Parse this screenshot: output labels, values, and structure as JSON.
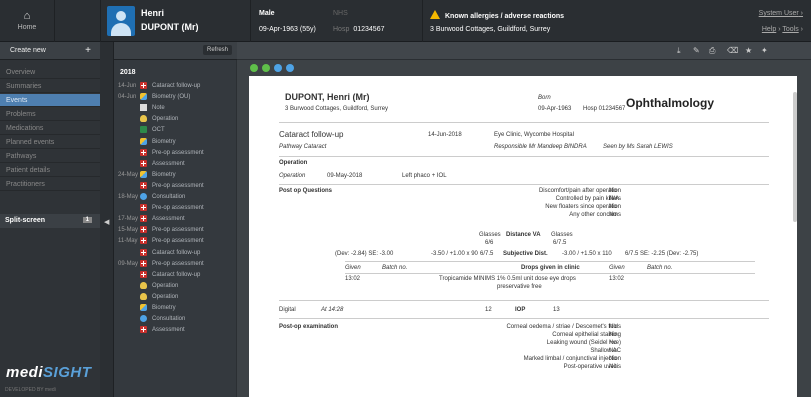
{
  "header": {
    "home_label": "Home",
    "patient_first": "Henri",
    "patient_last": "DUPONT (Mr)",
    "gender": "Male",
    "dob": "09-Apr-1963 (55y)",
    "nhs_label": "NHS",
    "hosp_label": "Hosp",
    "hosp_no": "01234567",
    "allergy": "Known allergies / adverse reactions",
    "address": "3 Burwood Cottages, Guildford, Surrey",
    "system_user": "System User",
    "help": "Help",
    "tools": "Tools",
    "warn_color": "#f5b800"
  },
  "nav": {
    "create_new": "Create new",
    "items": [
      "Overview",
      "Summaries",
      "Events",
      "Problems",
      "Medications",
      "Planned events",
      "Pathways",
      "Patient details",
      "Practitioners"
    ],
    "active": "Events",
    "split": "Split-screen",
    "split_badge": "1",
    "logo_main": "medi",
    "logo_accent": "SIGHT",
    "developed_by": "DEVELOPED BY  medi"
  },
  "events": {
    "refresh": "Refresh",
    "year": "2018",
    "list": [
      {
        "date": "14-Jun",
        "icon": "red-plus-icon",
        "label": "Cataract follow-up"
      },
      {
        "date": "04-Jun",
        "icon": "biometry-icon",
        "label": "Biometry (OU)"
      },
      {
        "date": "",
        "icon": "note-icon",
        "label": "Note"
      },
      {
        "date": "",
        "icon": "operation-icon",
        "label": "Operation"
      },
      {
        "date": "",
        "icon": "oct-icon",
        "label": "OCT"
      },
      {
        "date": "",
        "icon": "biometry-icon",
        "label": "Biometry"
      },
      {
        "date": "",
        "icon": "red-plus-icon",
        "label": "Pre-op assessment"
      },
      {
        "date": "",
        "icon": "red-plus-icon",
        "label": "Assessment"
      },
      {
        "date": "24-May",
        "icon": "biometry-icon",
        "label": "Biometry"
      },
      {
        "date": "",
        "icon": "red-plus-icon",
        "label": "Pre-op assessment"
      },
      {
        "date": "18-May",
        "icon": "consultation-icon",
        "label": "Consultation"
      },
      {
        "date": "",
        "icon": "red-plus-icon",
        "label": "Pre-op assessment"
      },
      {
        "date": "17-May",
        "icon": "red-plus-icon",
        "label": "Assessment"
      },
      {
        "date": "15-May",
        "icon": "red-plus-icon",
        "label": "Pre-op assessment"
      },
      {
        "date": "11-May",
        "icon": "red-plus-icon",
        "label": "Pre-op assessment"
      },
      {
        "date": "",
        "icon": "red-plus-icon",
        "label": "Cataract follow-up"
      },
      {
        "date": "09-May",
        "icon": "red-plus-icon",
        "label": "Pre-op assessment"
      },
      {
        "date": "",
        "icon": "red-plus-icon",
        "label": "Cataract follow-up"
      },
      {
        "date": "",
        "icon": "operation-icon",
        "label": "Operation"
      },
      {
        "date": "",
        "icon": "operation-icon",
        "label": "Operation"
      },
      {
        "date": "",
        "icon": "biometry-icon",
        "label": "Biometry"
      },
      {
        "date": "",
        "icon": "consultation-icon",
        "label": "Consultation"
      },
      {
        "date": "",
        "icon": "red-plus-icon",
        "label": "Assessment"
      }
    ]
  },
  "doc": {
    "name": "DUPONT, Henri (Mr)",
    "address": "3 Burwood Cottages, Guildford, Surrey",
    "born_label": "Born",
    "born": "09-Apr-1963",
    "hosp": "Hosp 01234567",
    "specialty": "Ophthalmology",
    "event_title": "Cataract follow-up",
    "event_date": "14-Jun-2018",
    "site": "Eye Clinic, Wycombe Hospital",
    "pathway": "Pathway Cataract",
    "responsible": "Responsible  Mr Mandeep BINDRA",
    "seen_by": "Seen by  Ms Sarah LEWIS",
    "operation_heading": "Operation",
    "operation_label": "Operation",
    "operation_date": "09-May-2018",
    "operation_value": "Left phaco + IOL",
    "postop_heading": "Post op Questions",
    "questions": [
      {
        "q": "Discomfort/pain after operation",
        "a": "No"
      },
      {
        "q": "Controlled by pain killers",
        "a": "N/A"
      },
      {
        "q": "New floaters since operation",
        "a": "No"
      },
      {
        "q": "Any other concerns",
        "a": "No"
      }
    ],
    "glasses": "Glasses",
    "va_right": "6/6",
    "distance_va": "Distance VA",
    "va_left": "6/7.5",
    "refraction_right": "(Dev: -2.84) SE: -3.00",
    "refraction_r2": "-3.50 / +1.00 x 90",
    "refraction_r3": "6/7.5",
    "subjective": "Subjective Dist.",
    "refraction_left": "-3.00 / +1.50 x 110",
    "refraction_l2": "6/7.5  SE: -2.25 (Dev: -2.75)",
    "given": "Given",
    "batch": "Batch no.",
    "drops_heading": "Drops given in clinic",
    "drop_time_r": "13:02",
    "drop_name": "Tropicamide MINIMS 1% 0.5ml unit dose eye drops",
    "drop_name2": "preservative free",
    "drop_time_l": "13:02",
    "iop_method": "Digital",
    "iop_time": "At 14:28",
    "iop_right": "12",
    "iop_label": "IOP",
    "iop_left": "13",
    "exam_heading": "Post-op examination",
    "exam": [
      {
        "q": "Corneal oedema / striae / Descemet's folds",
        "a": "No"
      },
      {
        "q": "Corneal epithelial staining",
        "a": "No"
      },
      {
        "q": "Leaking wound (Seidel +ve)",
        "a": "No"
      },
      {
        "q": "Shallow AC",
        "a": "No"
      },
      {
        "q": "Marked limbal / conjunctival injection",
        "a": "No"
      },
      {
        "q": "Post-operative uveitis",
        "a": "No"
      }
    ]
  }
}
